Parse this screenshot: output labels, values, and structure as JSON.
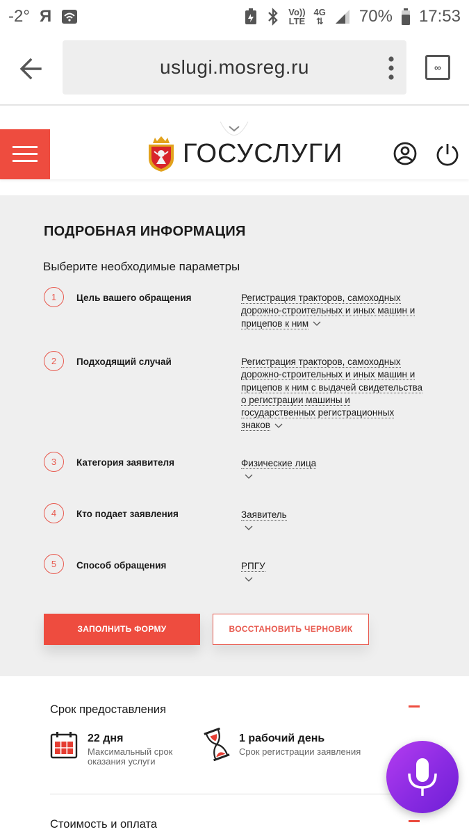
{
  "statusbar": {
    "temperature": "-2°",
    "yandex": "Я",
    "volte_top": "Vo))",
    "volte_bottom": "LTE",
    "network": "4G",
    "battery": "70%",
    "time": "17:53"
  },
  "browser": {
    "url": "uslugi.mosreg.ru",
    "tabs_label": "∞"
  },
  "header": {
    "logo_text": "ГОСУСЛУГИ",
    "accent_color": "#ee4c3f"
  },
  "details": {
    "title": "ПОДРОБНАЯ ИНФОРМАЦИЯ",
    "subtitle": "Выберите необходимые параметры",
    "steps": [
      {
        "num": "1",
        "label": "Цель вашего обращения",
        "value": "Регистрация тракторов, самоходных дорожно-строительных и иных машин и прицепов к ним"
      },
      {
        "num": "2",
        "label": "Подходящий случай",
        "value": "Регистрация тракторов, самоходных дорожно-строительных и иных машин и прицепов к ним с выдачей свидетельства о регистрации машины и государственных регистрационных знаков"
      },
      {
        "num": "3",
        "label": "Категория заявителя",
        "value": "Физические лица"
      },
      {
        "num": "4",
        "label": "Кто подает заявления",
        "value": "Заявитель"
      },
      {
        "num": "5",
        "label": "Способ обращения",
        "value": "РПГУ"
      }
    ],
    "fill_form_label": "ЗАПОЛНИТЬ ФОРМУ",
    "restore_draft_label": "ВОССТАНОВИТЬ ЧЕРНОВИК"
  },
  "term": {
    "title": "Срок предоставления",
    "max_term_value": "22 дня",
    "max_term_desc": "Максимальный срок оказания услуги",
    "reg_term_value": "1 рабочий день",
    "reg_term_desc": "Срок регистрации заявления"
  },
  "cost": {
    "title": "Стоимость и оплата"
  }
}
